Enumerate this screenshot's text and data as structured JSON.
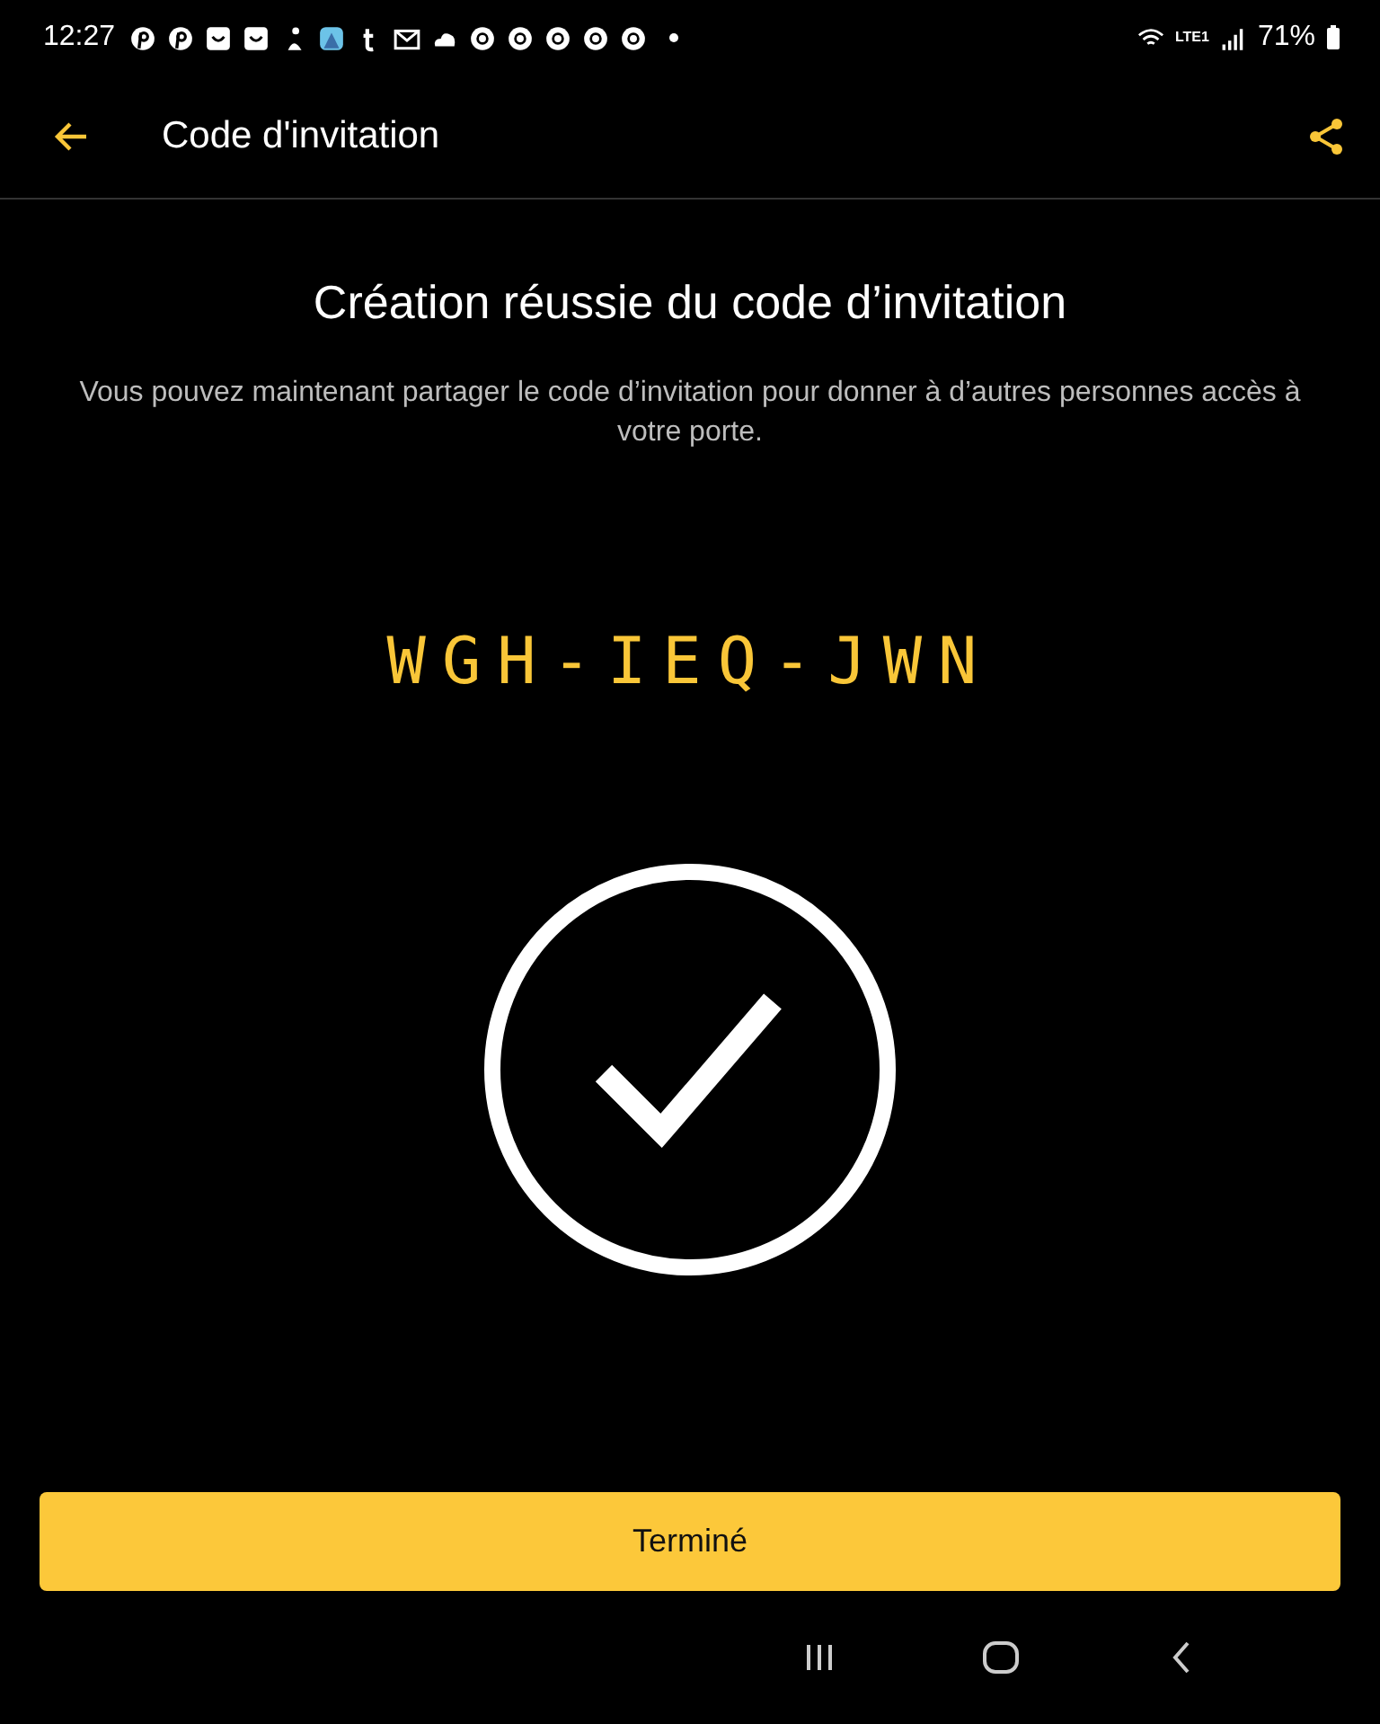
{
  "status_bar": {
    "time": "12:27",
    "battery": "71%",
    "network": "LTE1",
    "notifications": [
      {
        "kind": "pin"
      },
      {
        "kind": "pin"
      },
      {
        "kind": "smile"
      },
      {
        "kind": "smile"
      },
      {
        "kind": "figure"
      },
      {
        "kind": "app"
      },
      {
        "kind": "tumblr"
      },
      {
        "kind": "mail"
      },
      {
        "kind": "cloud"
      },
      {
        "kind": "chrome"
      },
      {
        "kind": "chrome"
      },
      {
        "kind": "chrome"
      },
      {
        "kind": "chrome"
      },
      {
        "kind": "chrome"
      },
      {
        "kind": "dot"
      }
    ]
  },
  "app_bar": {
    "title": "Code d'invitation"
  },
  "heading": "Création réussie du code d’invitation",
  "description": "Vous pouvez maintenant partager le code d’invitation pour donner à d’autres personnes accès à votre porte.",
  "code": "WGH-IEQ-JWN",
  "button": "Terminé"
}
